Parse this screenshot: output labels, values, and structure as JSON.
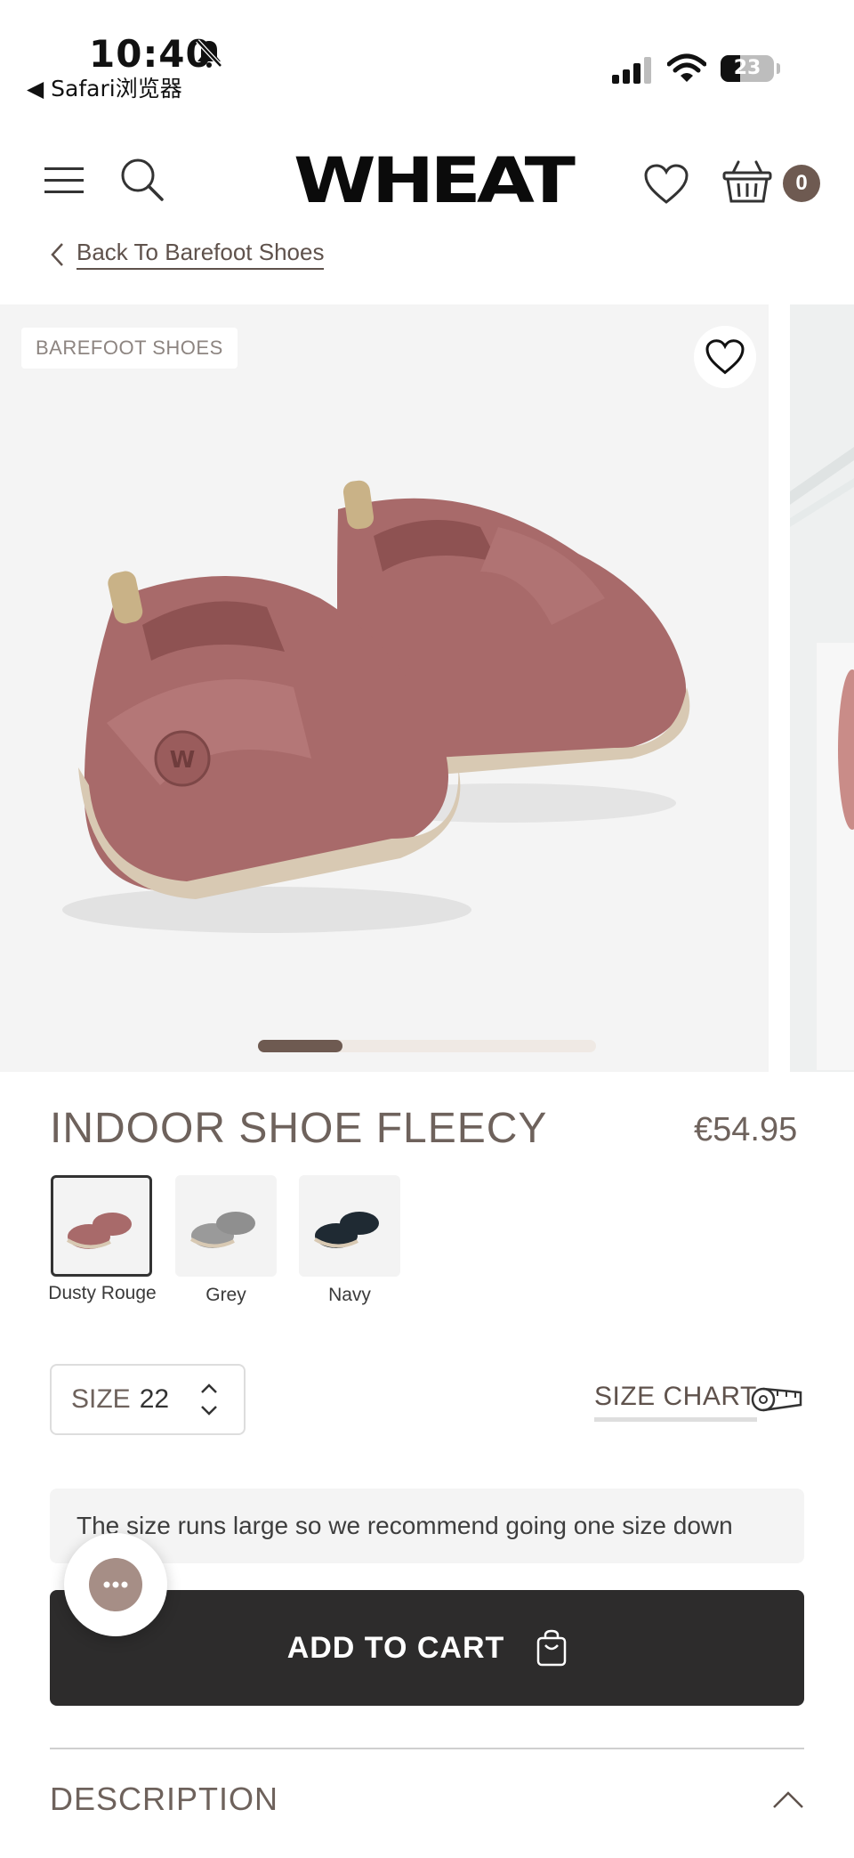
{
  "status_bar": {
    "time": "10:40",
    "back_app": "◀ Safari浏览器",
    "battery_level": "23"
  },
  "header": {
    "logo": "WHEAT",
    "cart_count": "0",
    "icons": [
      "menu-icon",
      "search-icon",
      "heart-icon",
      "basket-icon"
    ]
  },
  "breadcrumb": {
    "label": "Back To Barefoot Shoes"
  },
  "gallery": {
    "tag": "BAREFOOT SHOES",
    "progress_fraction": 0.25,
    "colors": {
      "shoe": "#a86a6a",
      "sole": "#d8c9b3",
      "background": "#f4f4f4"
    }
  },
  "product": {
    "title": "INDOOR SHOE FLEECY",
    "price": "€54.95",
    "colors": [
      {
        "label": "Dusty Rouge",
        "swatch": "#a86a6a",
        "selected": true
      },
      {
        "label": "Grey",
        "swatch": "#9a9a9a",
        "selected": false
      },
      {
        "label": "Navy",
        "swatch": "#1f2a33",
        "selected": false
      }
    ],
    "size_label": "SIZE",
    "size_value": "22",
    "size_chart": "SIZE CHART",
    "size_note": "The size runs large so we recommend going one size down",
    "add_to_cart": "ADD TO CART",
    "description": "DESCRIPTION"
  },
  "theme": {
    "accent": "#6e5a51",
    "button": "#2d2c2c"
  }
}
